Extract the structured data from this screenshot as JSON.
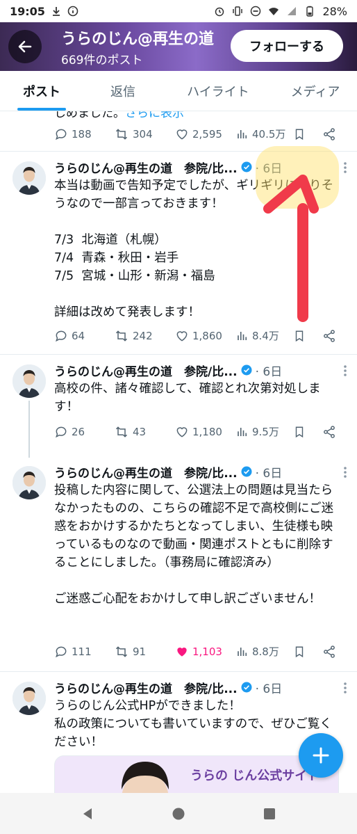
{
  "status_bar": {
    "time": "19:05",
    "battery": "28%"
  },
  "header": {
    "title": "うらのじん@再生の道　参院/比",
    "post_count": "669件のポスト",
    "follow_label": "フォローする"
  },
  "tabs": [
    {
      "label": "ポスト",
      "active": true
    },
    {
      "label": "返信",
      "active": false
    },
    {
      "label": "ハイライト",
      "active": false
    },
    {
      "label": "メディア",
      "active": false
    }
  ],
  "previous_tweet": {
    "cut_text": "しめました。",
    "more_link": "さらに表示",
    "replies": "188",
    "reposts": "304",
    "likes": "2,595",
    "views": "40.5万"
  },
  "tweets": [
    {
      "name": "うらのじん@再生の道　参院/比...",
      "date": "· 6日",
      "body": "本当は動画で告知予定でしたが、ギリギリになりそうなので一部言っておきます！\n\n7/3  北海道（札幌）\n7/4  青森・秋田・岩手\n7/5  宮城・山形・新潟・福島\n\n詳細は改めて発表します！",
      "replies": "64",
      "reposts": "242",
      "likes": "1,860",
      "views": "8.4万"
    },
    {
      "name": "うらのじん@再生の道　参院/比...",
      "date": "· 6日",
      "body": "高校の件、諸々確認して、確認とれ次第対処します！",
      "replies": "26",
      "reposts": "43",
      "likes": "1,180",
      "views": "9.5万"
    },
    {
      "name": "うらのじん@再生の道　参院/比...",
      "date": "· 6日",
      "body": "投稿した内容に関して、公選法上の問題は見当たらなかったものの、こちらの確認不足で高校側にご迷惑をおかけするかたちとなってしまい、生徒様も映っているものなので動画・関連ポストともに削除することにしました。（事務局に確認済み）\n\nご迷惑ご心配をおかけして申し訳ございません！",
      "replies": "111",
      "reposts": "91",
      "likes": "1,103",
      "views": "8.8万",
      "liked": true
    },
    {
      "name": "うらのじん@再生の道　参院/比...",
      "date": "· 6日",
      "body": "うらのじん公式HPができました！\n私の政策についても書いていますので、ぜひご覧ください！",
      "card_text": "うらの じん公式サイト"
    }
  ],
  "colors": {
    "accent": "#1d9bf0",
    "like_active": "#f91880",
    "annotation_arrow": "#f03a4a",
    "annotation_highlight": "#ffe066"
  },
  "icons": {
    "reply": "reply-icon",
    "repost": "repost-icon",
    "like": "heart-icon",
    "views": "views-icon",
    "bookmark": "bookmark-icon",
    "share": "share-icon",
    "fab": "compose-plus-icon"
  }
}
